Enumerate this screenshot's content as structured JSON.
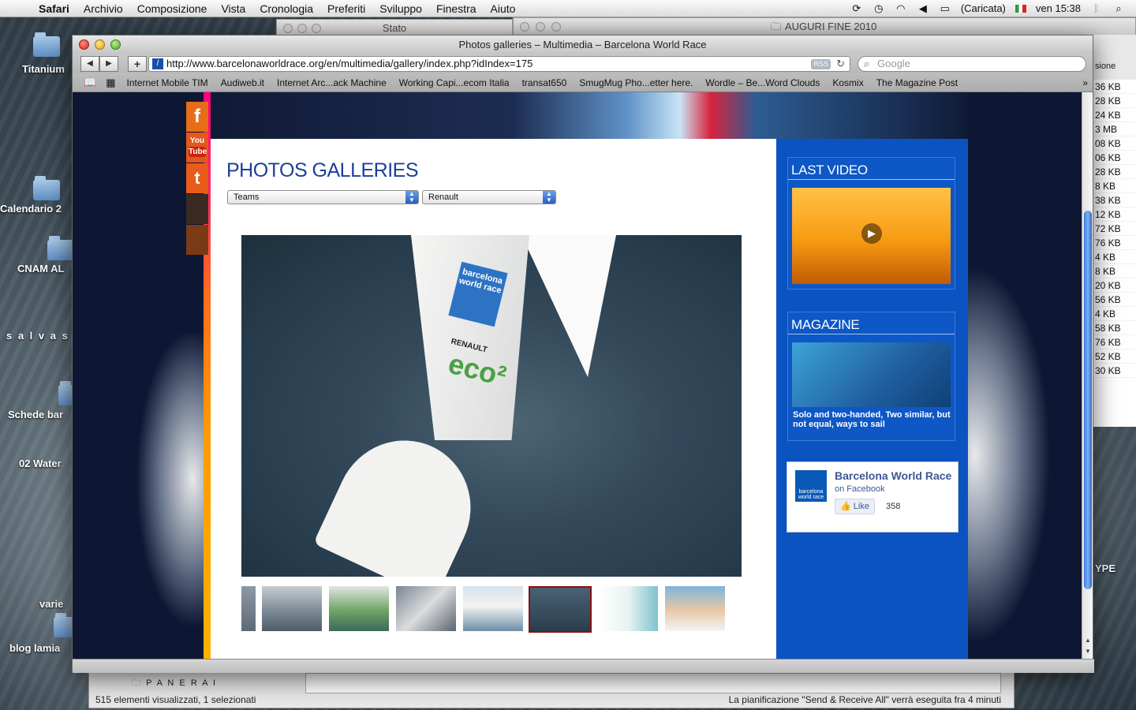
{
  "menubar": {
    "items": [
      "Safari",
      "Archivio",
      "Composizione",
      "Vista",
      "Cronologia",
      "Preferiti",
      "Sviluppo",
      "Finestra",
      "Aiuto"
    ],
    "battery": "(Caricata)",
    "clock": "ven 15:38"
  },
  "desktop": {
    "icons": [
      "Titanium",
      "Calendario 2",
      "CNAM AL",
      "s a l v a s c",
      "Schede bar",
      "02 Water",
      "varie",
      "blog lamia"
    ],
    "bg_window_title": "Stato",
    "bg_window_title2": "AUGURI FINE 2010",
    "filelist_header": "sione",
    "filelist": [
      "36 KB",
      "28 KB",
      "24 KB",
      "3 MB",
      "08 KB",
      "06 KB",
      "28 KB",
      "8 KB",
      "38 KB",
      "12 KB",
      "72 KB",
      "76 KB",
      "4 KB",
      "8 KB",
      "20 KB",
      "56 KB",
      "4 KB",
      "58 KB",
      "76 KB",
      "52 KB",
      "30 KB"
    ],
    "side_text": "YPE"
  },
  "finder_bottom": {
    "folder": "P A N E R A I",
    "status": "515 elementi visualizzati, 1 selezionati",
    "schedule": "La pianificazione \"Send & Receive All\" verrà eseguita fra 4 minuti"
  },
  "safari": {
    "window_title": "Photos galleries – Multimedia – Barcelona World Race",
    "url": "http://www.barcelonaworldrace.org/en/multimedia/gallery/index.php?idIndex=175",
    "rss": "RSS",
    "search_placeholder": "Google",
    "bookmarks": [
      "Internet Mobile TIM",
      "Audiweb.it",
      "Internet Arc...ack Machine",
      "Working Capi...ecom Italia",
      "transat650",
      "SmugMug Pho...etter here.",
      "Wordle – Be...Word Clouds",
      "Kosmix",
      "The Magazine Post"
    ]
  },
  "page": {
    "title": "PHOTOS GALLERIES",
    "select1": "Teams",
    "select2": "Renault",
    "social": [
      "f",
      "You",
      "Tube",
      "t"
    ],
    "sail_logo": "barcelona world race",
    "sail_renault": "RENAULT",
    "sail_eco": "eco²",
    "sidebar": {
      "last_video": "LAST VIDEO",
      "magazine": "MAGAZINE",
      "magazine_caption": "Solo and two-handed, Two similar, but not equal, ways to sail"
    },
    "facebook": {
      "name": "Barcelona World Race",
      "suffix": "on Facebook",
      "like": "Like",
      "count": "358",
      "logo_text": "barcelona world race"
    }
  },
  "colors": {
    "accent_blue": "#0b53c0",
    "title_blue": "#1c3f9a",
    "selected_thumb": "#8a0f13"
  }
}
